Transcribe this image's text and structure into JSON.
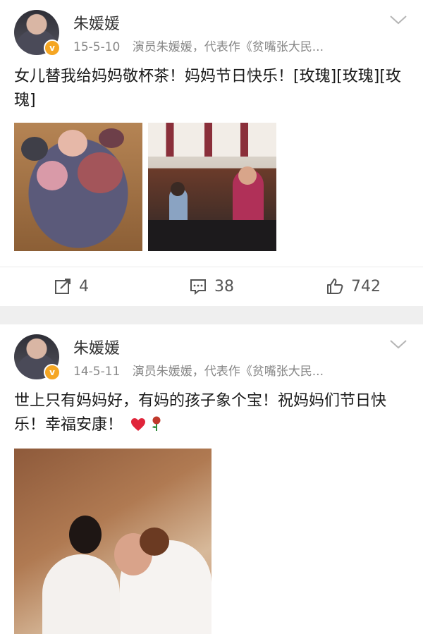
{
  "posts": [
    {
      "author": "朱媛媛",
      "verified_badge": "v",
      "time": "15-5-10",
      "source": "演员朱媛媛，代表作《贫嘴张大民...",
      "text": "女儿替我给妈妈敬杯茶！妈妈节日快乐！[玫瑰][玫瑰][玫瑰]",
      "images": [
        "flower-box-photo",
        "tea-ceremony-photo"
      ],
      "reposts": "4",
      "comments": "38",
      "likes": "742"
    },
    {
      "author": "朱媛媛",
      "verified_badge": "v",
      "time": "14-5-11",
      "source": "演员朱媛媛，代表作《贫嘴张大民...",
      "text": "世上只有妈妈好，有妈的孩子象个宝！祝妈妈们节日快乐！幸福安康！",
      "emojis": [
        "heart-emoji",
        "rose-emoji"
      ],
      "images": [
        "mother-daughter-wedding-photo"
      ]
    }
  ],
  "colors": {
    "verified": "#f5a623",
    "separator": "#efefef",
    "meta": "#888888",
    "heart": "#e0243a",
    "rose": "#c0392b"
  }
}
